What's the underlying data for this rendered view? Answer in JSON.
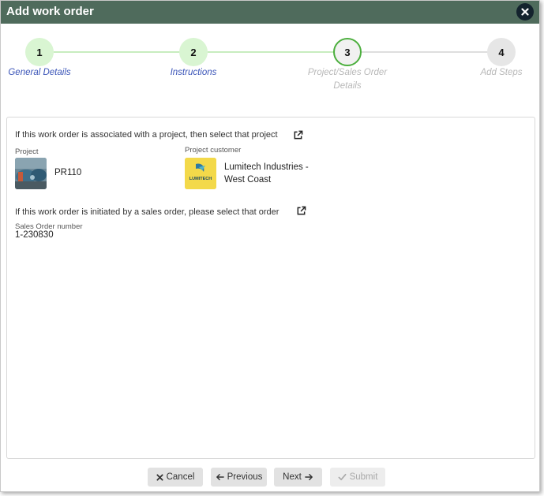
{
  "dialog": {
    "title": "Add work order"
  },
  "stepper": {
    "steps": [
      {
        "number": "1",
        "label": "General Details",
        "state": "completed"
      },
      {
        "number": "2",
        "label": "Instructions",
        "state": "completed"
      },
      {
        "number": "3",
        "label_line1": "Project/Sales Order",
        "label_line2": "Details",
        "state": "current"
      },
      {
        "number": "4",
        "label": "Add Steps",
        "state": "upcoming"
      }
    ]
  },
  "project_section": {
    "prompt": "If this work order is associated with a project, then select that project",
    "project_label": "Project",
    "project_value": "PR110",
    "customer_label": "Project customer",
    "customer_value_line1": "Lumitech Industries -",
    "customer_value_line2": "West Coast",
    "customer_logo_text": "LUMITECH"
  },
  "sales_section": {
    "prompt": "If this work order is initiated by a sales order, please select that order",
    "sales_order_label": "Sales Order number",
    "sales_order_value": "1-230830"
  },
  "footer": {
    "cancel_label": "Cancel",
    "previous_label": "Previous",
    "next_label": "Next",
    "submit_label": "Submit"
  },
  "colors": {
    "titlebar": "#4f6b5c",
    "step_completed": "#d9f5d2",
    "step_current_border": "#4caf3e",
    "step_upcoming": "#e6e6e6",
    "label_completed": "#3b55b8"
  }
}
